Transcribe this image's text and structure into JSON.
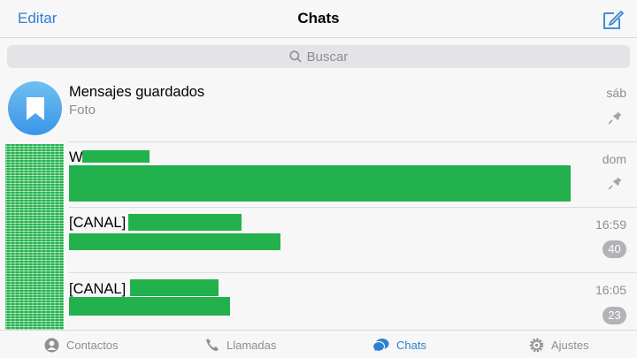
{
  "navbar": {
    "edit_label": "Editar",
    "title": "Chats",
    "compose_icon": "compose-icon"
  },
  "search": {
    "placeholder": "Buscar"
  },
  "chats": [
    {
      "name": "Mensajes guardados",
      "preview": "Foto",
      "time": "sáb",
      "pinned": true,
      "badge": ""
    },
    {
      "name": "W",
      "preview": "",
      "time": "dom",
      "pinned": true,
      "badge": ""
    },
    {
      "name": "[CANAL]",
      "preview": "",
      "time": "16:59",
      "pinned": false,
      "badge": "40"
    },
    {
      "name": "[CANAL]",
      "preview": "",
      "time": "16:05",
      "pinned": false,
      "badge": "23"
    }
  ],
  "tabs": [
    {
      "label": "Contactos",
      "icon": "contacts-icon",
      "active": false
    },
    {
      "label": "Llamadas",
      "icon": "phone-icon",
      "active": false
    },
    {
      "label": "Chats",
      "icon": "chats-icon",
      "active": true
    },
    {
      "label": "Ajustes",
      "icon": "settings-icon",
      "active": false
    }
  ],
  "colors": {
    "accent": "#2f7fd3",
    "redaction": "#22b14c",
    "badge": "#b2b2b7"
  }
}
